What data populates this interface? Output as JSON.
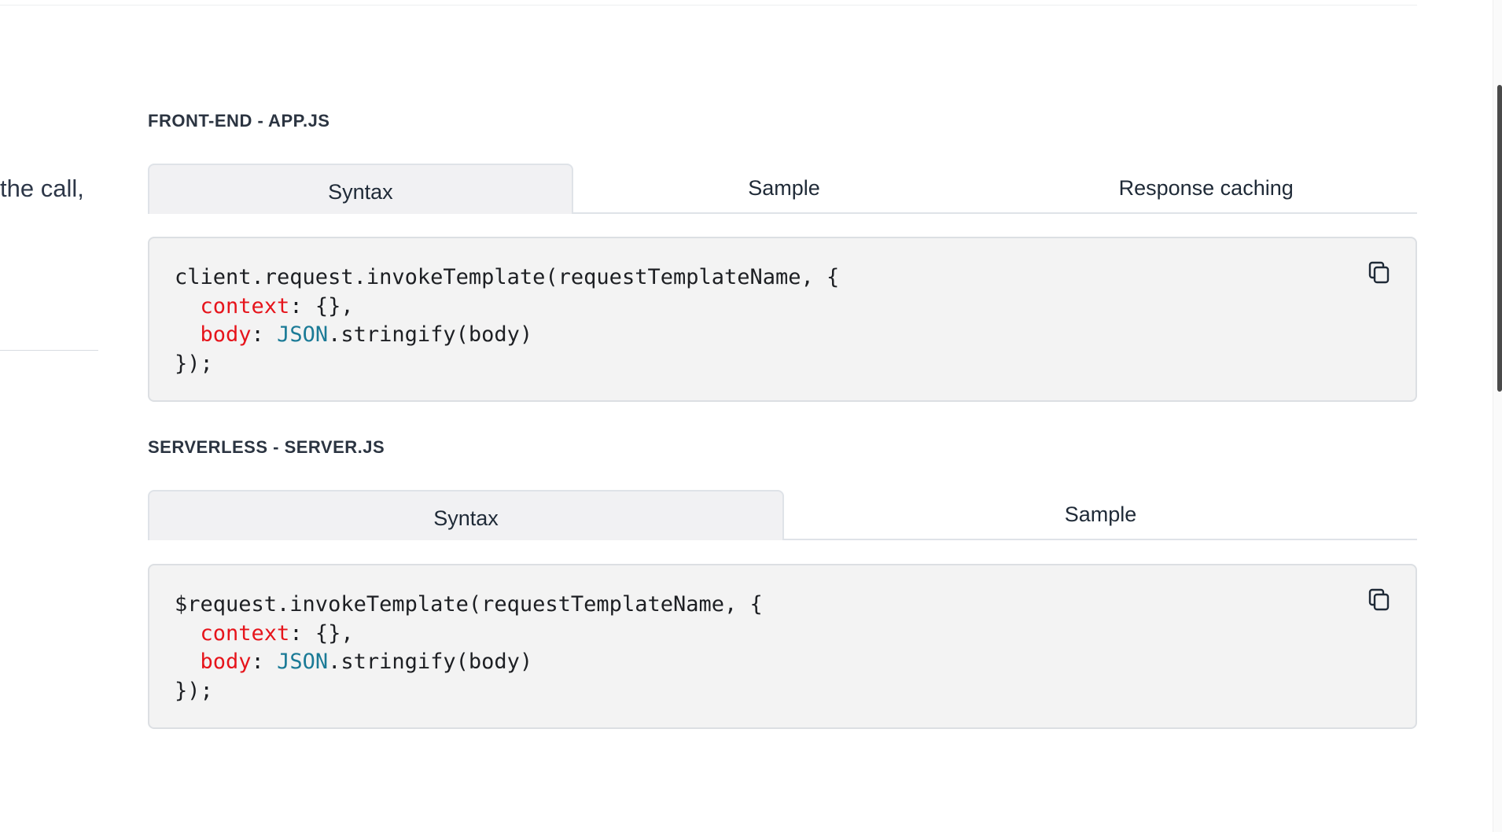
{
  "left_text": {
    "fragment": "the call,"
  },
  "frontend": {
    "title": "FRONT-END - APP.JS",
    "tabs": [
      "Syntax",
      "Sample",
      "Response caching"
    ],
    "active_tab": "Syntax",
    "code": {
      "line1": "client.request.invokeTemplate(requestTemplateName, {",
      "indent": "  ",
      "context_key": "context",
      "context_rest": ": {},",
      "body_key": "body",
      "colon": ": ",
      "json_obj": "JSON",
      "stringify_rest": ".stringify(body)",
      "closing": "});"
    },
    "copy_icon": "copy-icon"
  },
  "serverless": {
    "title": "SERVERLESS - SERVER.JS",
    "tabs": [
      "Syntax",
      "Sample"
    ],
    "active_tab": "Syntax",
    "code": {
      "line1": "$request.invokeTemplate(requestTemplateName, {",
      "indent": "  ",
      "context_key": "context",
      "context_rest": ": {},",
      "body_key": "body",
      "colon": ": ",
      "json_obj": "JSON",
      "stringify_rest": ".stringify(body)",
      "closing": "});"
    },
    "copy_icon": "copy-icon"
  },
  "colors": {
    "keyword": "#e6141b",
    "builtin": "#1a7a96",
    "code_bg": "#f3f3f3"
  }
}
